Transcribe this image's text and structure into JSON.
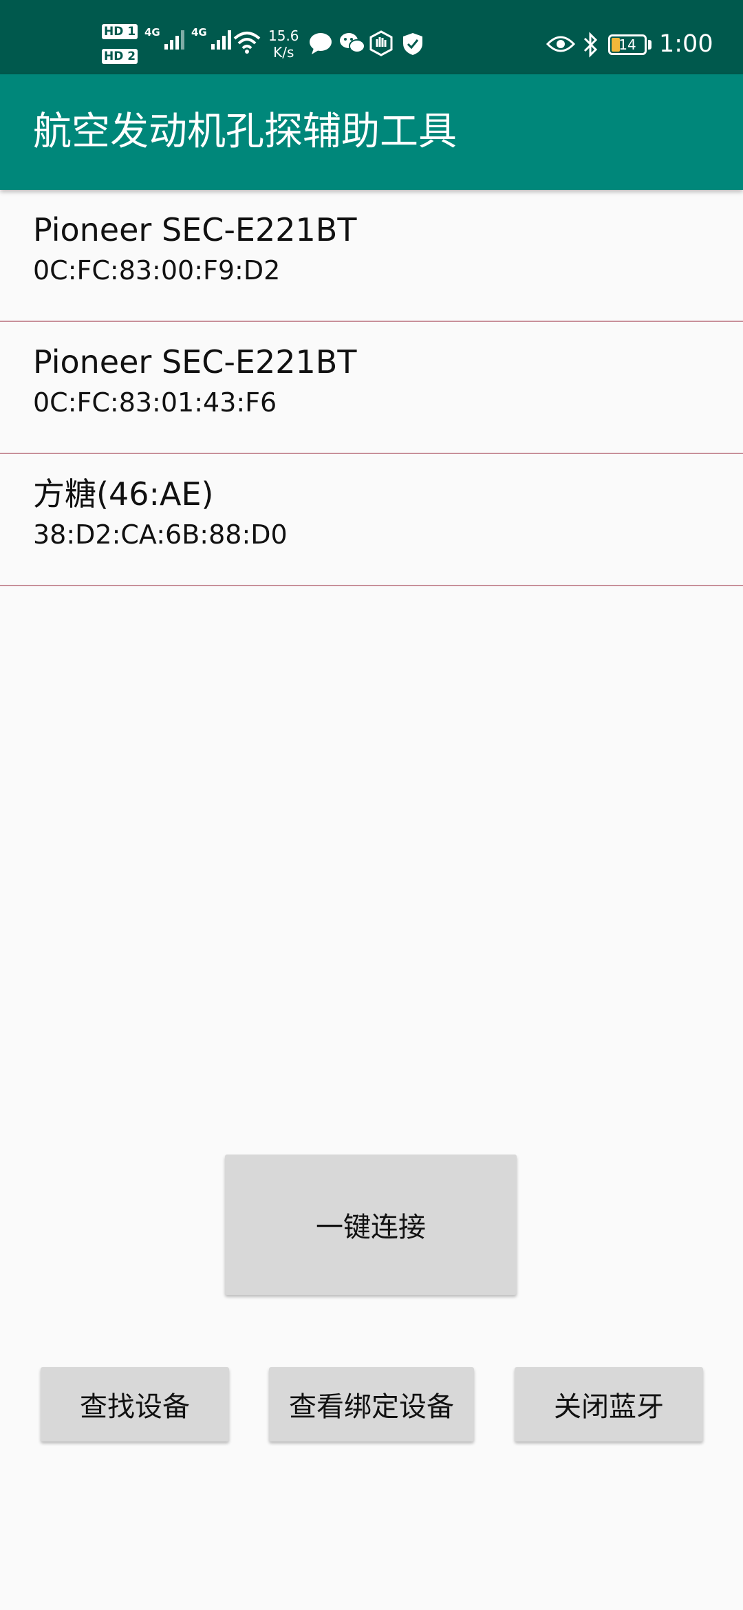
{
  "status_bar": {
    "hd1": "HD 1",
    "hd2": "HD 2",
    "net1": "4G",
    "net2": "4G",
    "speed_value": "15.6",
    "speed_unit": "K/s",
    "battery": "14",
    "time": "1:00",
    "icons": [
      "hd-icon",
      "signal-icon",
      "wifi-icon",
      "chat-bubble-icon",
      "wechat-icon",
      "hand-icon",
      "shield-check-icon",
      "eye-icon",
      "bluetooth-icon",
      "battery-icon"
    ]
  },
  "app_bar": {
    "title": "航空发动机孔探辅助工具"
  },
  "devices": [
    {
      "name": "Pioneer SEC-E221BT",
      "mac": "0C:FC:83:00:F9:D2"
    },
    {
      "name": "Pioneer SEC-E221BT",
      "mac": "0C:FC:83:01:43:F6"
    },
    {
      "name": "方糖(46:AE)",
      "mac": "38:D2:CA:6B:88:D0"
    }
  ],
  "buttons": {
    "connect": "一键连接",
    "search": "查找设备",
    "bonded": "查看绑定设备",
    "close_bt": "关闭蓝牙"
  },
  "colors": {
    "status_bar": "#00594d",
    "app_bar": "#00877a",
    "divider": "#c8909a",
    "button": "#d8d8d8",
    "background": "#fafafa"
  }
}
